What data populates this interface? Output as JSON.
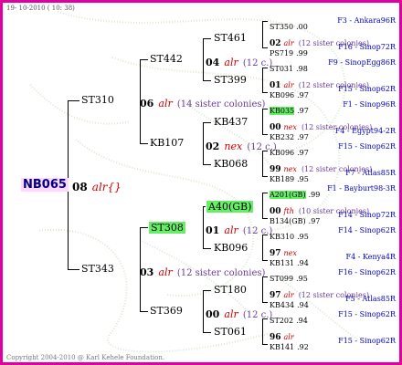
{
  "header": {
    "date": "19- 10-2010 ( 10: 38)"
  },
  "footer": {
    "copyright": "Copyright 2004-2010 @ Karl Kehele Foundation."
  },
  "tree": {
    "root": {
      "name": "NB065",
      "year": "08",
      "colony": "alr{}"
    },
    "g1": [
      {
        "name": "ST310",
        "year": "06",
        "colony": "alr",
        "siblings": "(14 sister colonies)"
      },
      {
        "name": "ST343",
        "year": "03",
        "colony": "alr",
        "siblings": "(12 sister colonies)"
      }
    ],
    "g2": [
      {
        "name": "ST442",
        "year": "04",
        "colony": "alr",
        "siblings": "(12 c.)"
      },
      {
        "name": "KB107",
        "year": "02",
        "colony": "nex",
        "siblings": "(12 c.)"
      },
      {
        "name": "ST308",
        "year": "01",
        "colony": "alr",
        "siblings": "(12 c.)"
      },
      {
        "name": "ST369",
        "year": "00",
        "colony": "alr",
        "siblings": "(12 c.)"
      }
    ],
    "g3": [
      "ST461",
      "ST399",
      "KB437",
      "KB068",
      "A40(GB)",
      "KB096",
      "ST180",
      "ST061"
    ],
    "g4": [
      {
        "name": "ST350",
        "year": ".00",
        "colony": "",
        "siblings": "",
        "origin": "F3 - Ankara96R"
      },
      {
        "name": "",
        "year": "02",
        "colony": "alr",
        "siblings": "(12 sister colonies)",
        "origin": ""
      },
      {
        "name": "PS719",
        "year": ".99",
        "colony": "",
        "siblings": "",
        "origin": "F16 - Sinop72R"
      },
      {
        "name": "ST031",
        "year": ".98",
        "colony": "",
        "siblings": "",
        "origin": "F9 - SinopEgg86R"
      },
      {
        "name": "",
        "year": "01",
        "colony": "alr",
        "siblings": "(12 sister colonies)",
        "origin": ""
      },
      {
        "name": "KB096",
        "year": ".97",
        "colony": "",
        "siblings": "",
        "origin": "F15 - Sinop62R"
      },
      {
        "name": "KB035",
        "year": ".97",
        "colony": "",
        "siblings": "",
        "origin": "F1 - Sinop96R"
      },
      {
        "name": "",
        "year": "00",
        "colony": "nex",
        "siblings": "(12 sister colonies)",
        "origin": ""
      },
      {
        "name": "KB232",
        "year": ".97",
        "colony": "",
        "siblings": "",
        "origin": "F4 - Egypt94-2R"
      },
      {
        "name": "KB096",
        "year": ".97",
        "colony": "",
        "siblings": "",
        "origin": "F15 - Sinop62R"
      },
      {
        "name": "",
        "year": "99",
        "colony": "nex",
        "siblings": "(12 sister colonies)",
        "origin": ""
      },
      {
        "name": "KB189",
        "year": ".95",
        "colony": "",
        "siblings": "",
        "origin": "F7 - Atlas85R"
      },
      {
        "name": "A201(GB)",
        "year": ".99",
        "colony": "",
        "siblings": "",
        "origin": "F1 - Bayburt98-3R"
      },
      {
        "name": "",
        "year": "00",
        "colony": "fth",
        "siblings": "(10 sister colonies)",
        "origin": ""
      },
      {
        "name": "B134(GB)",
        "year": ".97",
        "colony": "",
        "siblings": "",
        "origin": "F14 - Sinop72R"
      },
      {
        "name": "KB310",
        "year": ".95",
        "colony": "",
        "siblings": "",
        "origin": "F14 - Sinop62R"
      },
      {
        "name": "",
        "year": "97",
        "colony": "nex",
        "siblings": "",
        "origin": ""
      },
      {
        "name": "KB131",
        "year": ".94",
        "colony": "",
        "siblings": "",
        "origin": "F4 - Kenya4R"
      },
      {
        "name": "ST099",
        "year": ".95",
        "colony": "",
        "siblings": "",
        "origin": "F16 - Sinop62R"
      },
      {
        "name": "",
        "year": "97",
        "colony": "alr",
        "siblings": "(12 sister colonies)",
        "origin": ""
      },
      {
        "name": "KB434",
        "year": ".94",
        "colony": "",
        "siblings": "",
        "origin": "F5 - Atlas85R"
      },
      {
        "name": "ST202",
        "year": ".94",
        "colony": "",
        "siblings": "",
        "origin": "F15 - Sinop62R"
      },
      {
        "name": "",
        "year": "96",
        "colony": "alr",
        "siblings": "",
        "origin": ""
      },
      {
        "name": "KB141",
        "year": ".92",
        "colony": "",
        "siblings": "",
        "origin": "F15 - Sinop62R"
      }
    ]
  }
}
